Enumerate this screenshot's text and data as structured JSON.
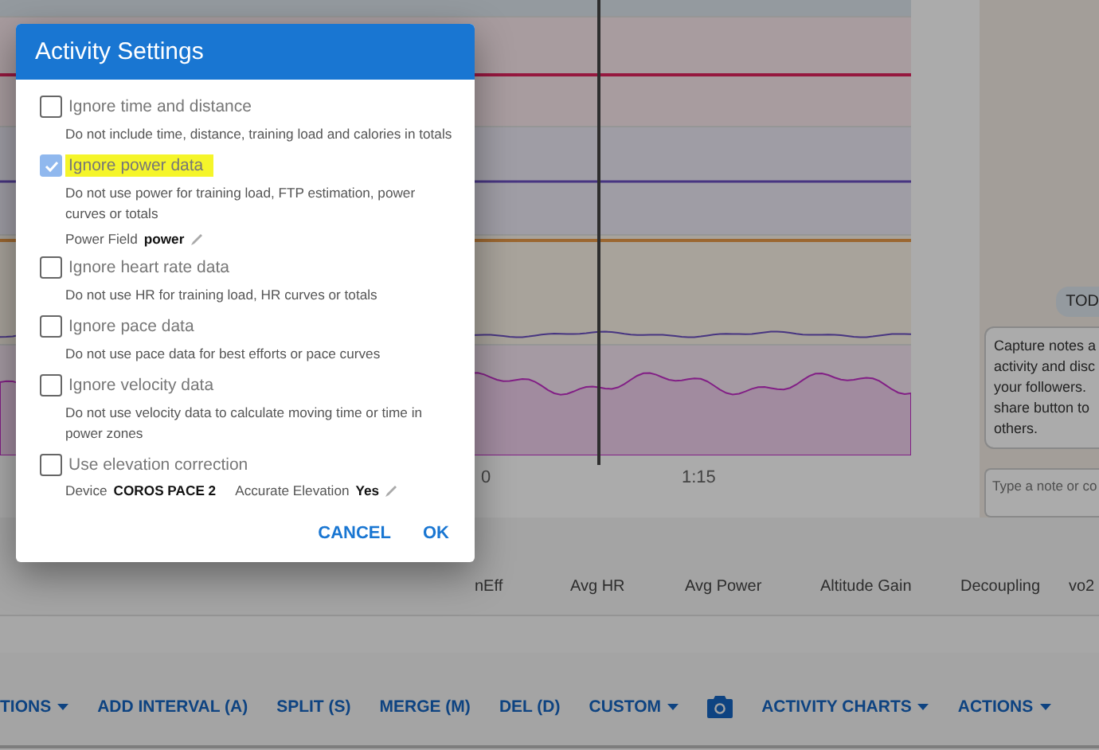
{
  "chart": {
    "axis_labels": [
      "0",
      "1:15"
    ]
  },
  "notes": {
    "badge": "TOD",
    "message": "Capture notes a\nactivity and disc\nyour followers.\nshare button to\nothers.",
    "placeholder": "Type a note or co"
  },
  "table": {
    "columns": [
      "nEff",
      "Avg HR",
      "Avg Power",
      "Altitude Gain",
      "Decoupling",
      "vo2"
    ]
  },
  "toolbar": [
    {
      "kind": "button",
      "label": "TIONS",
      "dropdown": true
    },
    {
      "kind": "button",
      "label": "ADD INTERVAL (A)",
      "dropdown": false
    },
    {
      "kind": "button",
      "label": "SPLIT (S)",
      "dropdown": false
    },
    {
      "kind": "button",
      "label": "MERGE (M)",
      "dropdown": false
    },
    {
      "kind": "button",
      "label": "DEL (D)",
      "dropdown": false
    },
    {
      "kind": "button",
      "label": "CUSTOM",
      "dropdown": true
    },
    {
      "kind": "camera"
    },
    {
      "kind": "button",
      "label": "ACTIVITY CHARTS",
      "dropdown": true
    },
    {
      "kind": "button",
      "label": "ACTIONS",
      "dropdown": true
    }
  ],
  "dialog": {
    "title": "Activity Settings",
    "options": [
      {
        "label": "Ignore time and distance",
        "checked": false,
        "highlighted": false,
        "description": "Do not include time, distance, training load and calories in totals"
      },
      {
        "label": "Ignore power data",
        "checked": true,
        "highlighted": true,
        "description": "Do not use power for training load, FTP estimation, power curves or totals",
        "fields": [
          {
            "label": "Power Field",
            "value": "power",
            "editable": true
          }
        ]
      },
      {
        "label": "Ignore heart rate data",
        "checked": false,
        "highlighted": false,
        "description": "Do not use HR for training load, HR curves or totals"
      },
      {
        "label": "Ignore pace data",
        "checked": false,
        "highlighted": false,
        "description": "Do not use pace data for best efforts or pace curves"
      },
      {
        "label": "Ignore velocity data",
        "checked": false,
        "highlighted": false,
        "description": "Do not use velocity data to calculate moving time or time in power zones"
      },
      {
        "label": "Use elevation correction",
        "checked": false,
        "highlighted": false,
        "fields": [
          {
            "label": "Device",
            "value": "COROS PACE 2",
            "editable": false
          },
          {
            "label": "Accurate Elevation",
            "value": "Yes",
            "editable": true
          }
        ]
      }
    ],
    "buttons": [
      "CANCEL",
      "OK"
    ]
  }
}
